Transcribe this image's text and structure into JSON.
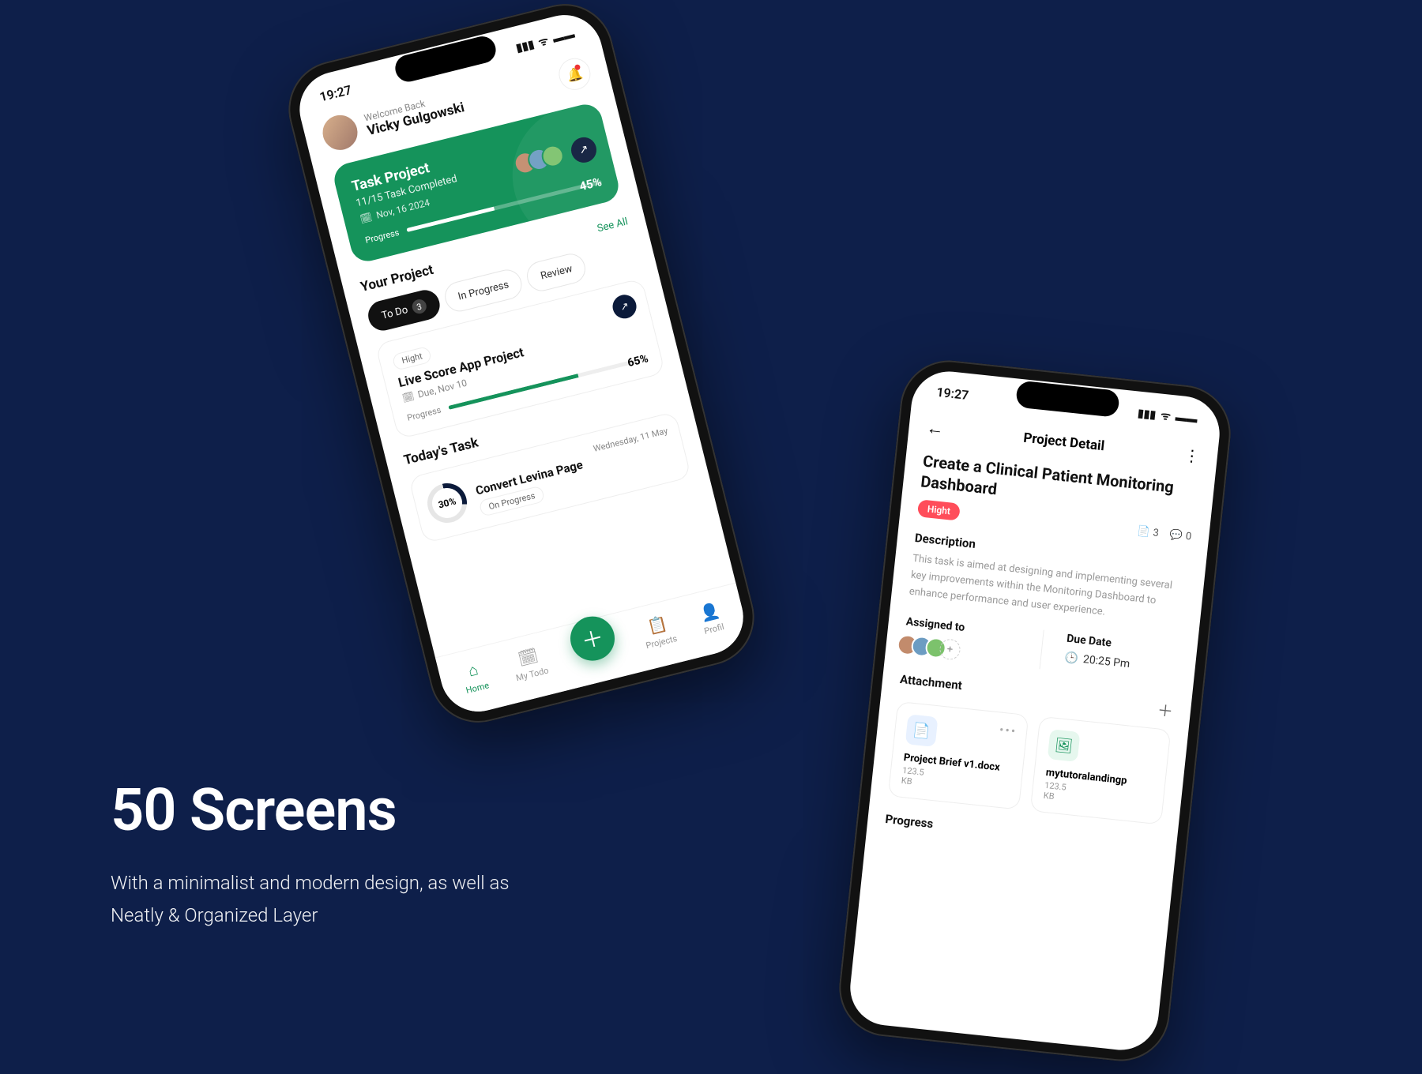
{
  "marketing": {
    "headline": "50 Screens",
    "line1": "With a minimalist and modern design, as well as",
    "line2": "Neatly & Organized Layer"
  },
  "status_time": "19:27",
  "phone1": {
    "welcome": "Welcome Back",
    "user_name": "Vicky Gulgowski",
    "task_card": {
      "title": "Task Project",
      "subtitle": "11/15 Task Completed",
      "date": "Nov, 16 2024",
      "progress_label": "Progress",
      "percent": "45%"
    },
    "your_project_label": "Your Project",
    "see_all": "See All",
    "chips": {
      "todo": "To Do",
      "todo_count": "3",
      "in_progress": "In Progress",
      "review": "Review"
    },
    "project": {
      "badge": "Hight",
      "title": "Live Score App Project",
      "due": "Due, Nov 10",
      "progress_label": "Progress",
      "percent": "65%"
    },
    "today_label": "Today's Task",
    "today_task": {
      "ring": "30%",
      "date": "Wednesday, 11 May",
      "title": "Convert Levina Page",
      "status": "On Progress"
    },
    "nav": {
      "home": "Home",
      "mytodo": "My Todo",
      "projects": "Projects",
      "profil": "Profil"
    }
  },
  "phone2": {
    "header_title": "Project Detail",
    "title": "Create a Clinical Patient Monitoring Dashboard",
    "priority": "Hight",
    "attachments_count": "3",
    "comments_count": "0",
    "desc_label": "Description",
    "desc": "This task is aimed at designing and implementing several key improvements within the Monitoring Dashboard to enhance performance and user experience.",
    "assigned_label": "Assigned to",
    "due_label": "Due Date",
    "due_value": "20:25 Pm",
    "attachment_label": "Attachment",
    "attachments": [
      {
        "name": "Project Brief v1.docx",
        "size": "123.5",
        "unit": "KB"
      },
      {
        "name": "mytutoralandingp",
        "size": "123.5",
        "unit": "KB"
      }
    ],
    "progress_label": "Progress"
  }
}
